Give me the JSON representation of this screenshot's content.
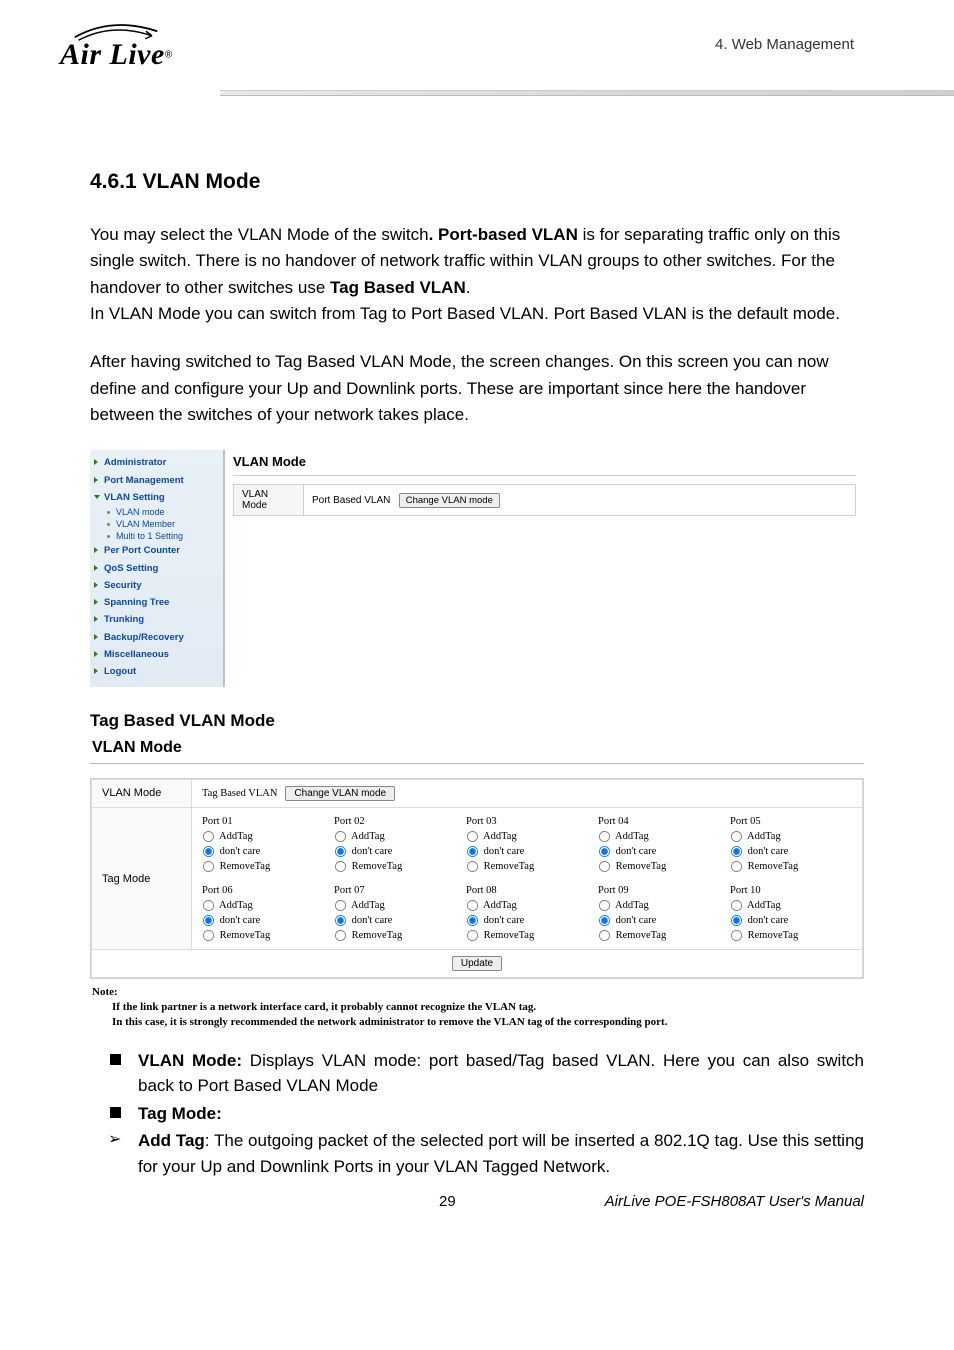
{
  "header": {
    "logo_text": "Air Live",
    "reg_mark": "®",
    "chapter": "4.  Web Management"
  },
  "section_title": "4.6.1 VLAN Mode",
  "para1_a": "You may select the VLAN Mode of the switch",
  "para1_b": ". Port-based VLAN",
  "para1_c": " is for separating traffic only on this single switch. There is no handover of network traffic within VLAN groups to other switches. For the handover to other switches use ",
  "para1_d": "Tag Based VLAN",
  "para1_e": ".",
  "para2": "In VLAN Mode you can switch from Tag to Port Based VLAN. Port Based VLAN is the default mode.",
  "para3": "After having switched to Tag Based VLAN Mode, the screen changes. On this screen you can now define and configure your Up and Downlink ports. These are important since here the handover between the switches of your network takes place.",
  "ss1": {
    "menu": {
      "administrator": "Administrator",
      "port_management": "Port Management",
      "vlan_setting": "VLAN Setting",
      "sub": {
        "vlan_mode": "VLAN mode",
        "vlan_member": "VLAN Member",
        "multi": "Multi to 1 Setting"
      },
      "per_port_counter": "Per Port Counter",
      "qos_setting": "QoS Setting",
      "security": "Security",
      "spanning_tree": "Spanning Tree",
      "trunking": "Trunking",
      "backup": "Backup/Recovery",
      "misc": "Miscellaneous",
      "logout": "Logout"
    },
    "main_title": "VLAN Mode",
    "row_label": "VLAN Mode",
    "row_value": "Port Based VLAN",
    "change_btn": "Change VLAN mode"
  },
  "sub_heading": "Tag Based VLAN Mode",
  "ss2_title": "VLAN Mode",
  "ss2": {
    "row1_label": "VLAN Mode",
    "row1_value": "Tag Based VLAN",
    "change_btn": "Change VLAN mode",
    "row2_label": "Tag Mode",
    "opts": {
      "add": "AddTag",
      "dont": "don't care",
      "remove": "RemoveTag"
    },
    "ports": [
      "Port 01",
      "Port 02",
      "Port 03",
      "Port 04",
      "Port 05",
      "Port 06",
      "Port 07",
      "Port 08",
      "Port 09",
      "Port 10"
    ],
    "selected": "dont",
    "update_btn": "Update"
  },
  "note": {
    "title": "Note:",
    "line1": "If the link partner is a network interface card, it probably cannot recognize the VLAN tag.",
    "line2": "In this case, it is strongly recommended the network administrator to remove the VLAN tag of the corresponding port."
  },
  "bullets": {
    "vlan_mode_label": "VLAN Mode:",
    "vlan_mode_text": " Displays VLAN mode: port based/Tag based VLAN. Here you can also switch back to Port Based VLAN Mode",
    "tag_mode_label": "Tag Mode:",
    "add_tag_label": "Add Tag",
    "add_tag_text": ": The outgoing packet of the selected port will be inserted a 802.1Q tag. Use this setting for your Up and Downlink Ports in your VLAN Tagged Network."
  },
  "footer": {
    "page_no": "29",
    "manual": "AirLive POE-FSH808AT User's Manual"
  }
}
